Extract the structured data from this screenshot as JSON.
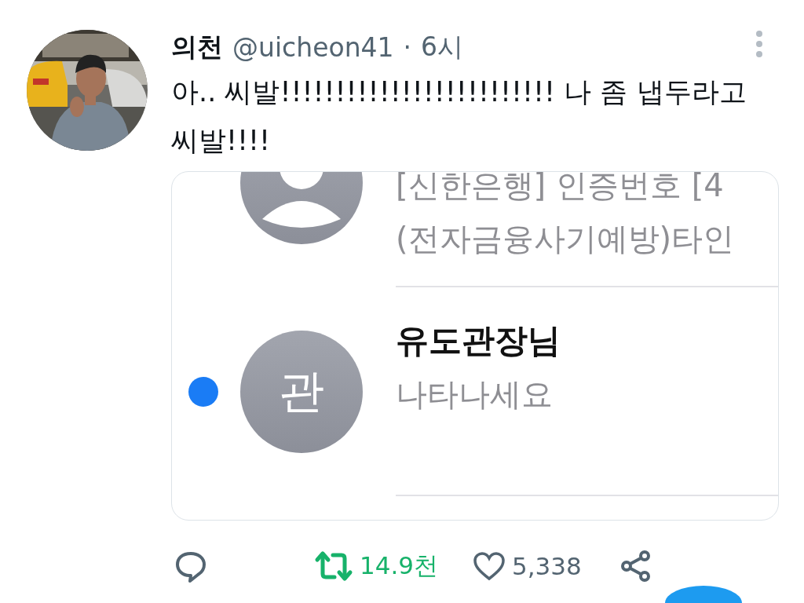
{
  "tweet": {
    "author": {
      "name": "의천",
      "handle": "@uicheon41",
      "separator": "·",
      "time": "6시"
    },
    "text": "아.. 씨발!!!!!!!!!!!!!!!!!!!!!!!!! 나 좀 냅두라고 씨발!!!!",
    "attached_screenshot": {
      "messages": [
        {
          "avatar": {
            "kind": "silhouette"
          },
          "preview_lines": [
            "[신한은행] 인증번호 [4",
            "(전자금융사기예방)타인"
          ],
          "unread": false
        },
        {
          "avatar": {
            "kind": "initial",
            "text": "관"
          },
          "title": "유도관장님",
          "preview_lines": [
            "나타나세요"
          ],
          "unread": true
        }
      ]
    },
    "actions": [
      {
        "kind": "reply"
      },
      {
        "kind": "retweet",
        "count": "14.9천",
        "active": true
      },
      {
        "kind": "like",
        "count": "5,338",
        "active": false
      },
      {
        "kind": "share"
      }
    ]
  }
}
